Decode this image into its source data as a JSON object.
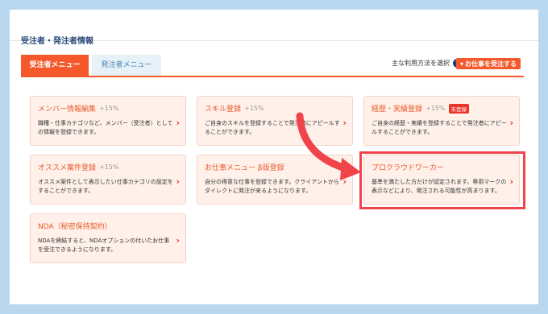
{
  "page_title": "受注者・発注者情報",
  "tabs": [
    {
      "label": "受注者メニュー",
      "active": true
    },
    {
      "label": "発注者メニュー",
      "active": false
    }
  ],
  "howto": {
    "label": "主な利用方法を選択",
    "icon": "question-circle-icon"
  },
  "accept_button": {
    "label": "お仕事を受注する",
    "icon": "chevron-down-icon"
  },
  "cards": [
    {
      "title": "メンバー情報編集",
      "pct": "+15%",
      "badge": "",
      "desc": "職種・仕事カテゴリなど、メンバー（受注者）としての情報を登録できます。"
    },
    {
      "title": "スキル登録",
      "pct": "+15%",
      "badge": "",
      "desc": "ご自身のスキルを登録することで発注者にアピールすることができます。"
    },
    {
      "title": "経歴・実績登録",
      "pct": "+15%",
      "badge": "未登録",
      "desc": "ご自身の経歴・実績を登録することで発注者にアピールすることができます。"
    },
    {
      "title": "オススメ案件登録",
      "pct": "+15%",
      "badge": "",
      "desc": "オススメ案件として表示したい仕事カテゴリの設定をすることができます。"
    },
    {
      "title": "お仕事メニュー β版登録",
      "pct": "",
      "badge": "",
      "desc": "自分の得意な仕事を登録できます。クライアントからダイレクトに発注が来るようになります。"
    },
    {
      "title": "プロクラウドワーカー",
      "pct": "",
      "badge": "",
      "desc": "基準を満たした方だけが認定されます。専用マークの表示などにより、発注される可能性が高まります。"
    },
    {
      "title": "NDA（秘密保持契約）",
      "pct": "",
      "badge": "",
      "desc": "NDAを締結すると、NDAオプションの付いたお仕事を受注できるようになります。"
    }
  ],
  "colors": {
    "accent": "#f4582b",
    "highlight": "#f0434a",
    "card_bg": "#fff1ea",
    "frame_bg": "#b9d7ef"
  }
}
